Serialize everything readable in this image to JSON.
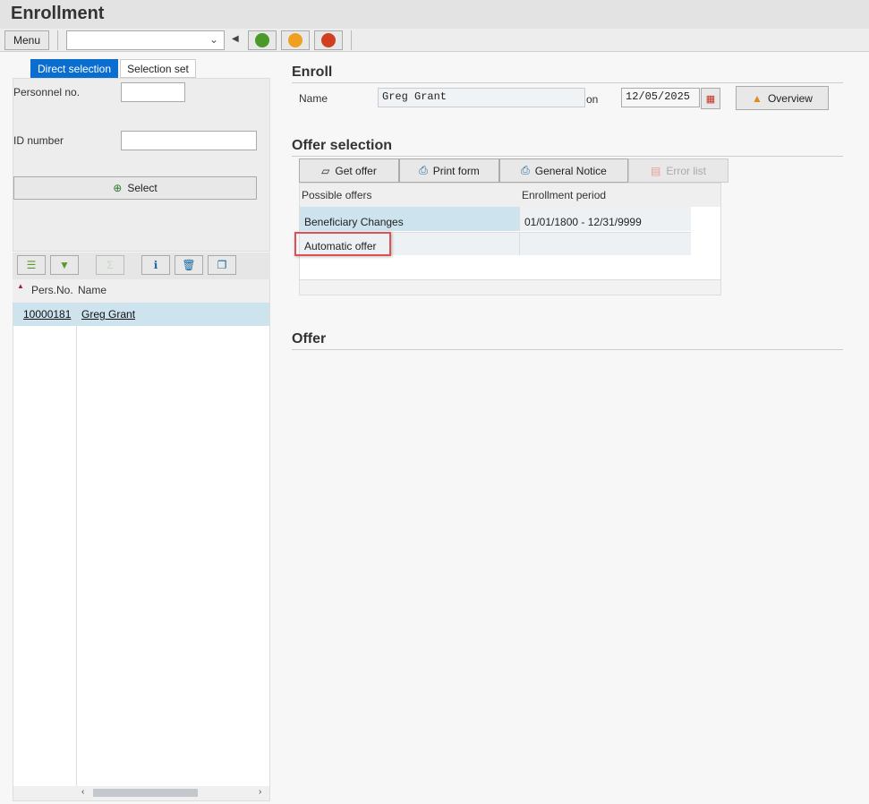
{
  "title": "Enrollment",
  "toolbar": {
    "menu": "Menu",
    "command_value": ""
  },
  "left": {
    "tabs": [
      "Direct selection",
      "Selection set"
    ],
    "personnel_label": "Personnel no.",
    "personnel_value": "",
    "id_label": "ID number",
    "id_value": "",
    "select": "Select",
    "columns": [
      "Pers.No.",
      "Name"
    ],
    "rows": [
      {
        "pers_no": "10000181",
        "name": "Greg Grant"
      }
    ]
  },
  "enroll": {
    "heading": "Enroll",
    "name_label": "Name",
    "name_value": "Greg Grant",
    "on_label": "on",
    "date": "12/05/2025",
    "overview": "Overview"
  },
  "offer_selection": {
    "heading": "Offer selection",
    "buttons": [
      "Get offer",
      "Print form",
      "General Notice",
      "Error list"
    ],
    "columns": [
      "Possible offers",
      "Enrollment period"
    ],
    "rows": [
      {
        "offer": "Beneficiary Changes",
        "period": "01/01/1800 - 12/31/9999"
      },
      {
        "offer": "Automatic offer",
        "period": ""
      }
    ]
  },
  "offer": {
    "heading": "Offer"
  }
}
